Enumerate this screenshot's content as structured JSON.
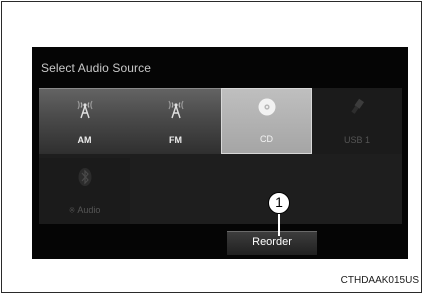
{
  "screen": {
    "title": "Select Audio Source"
  },
  "sources": [
    {
      "label": "AM",
      "icon": "antenna-icon",
      "state": "normal"
    },
    {
      "label": "FM",
      "icon": "antenna-icon",
      "state": "normal"
    },
    {
      "label": "CD",
      "icon": "disc-icon",
      "state": "selected"
    },
    {
      "label": "USB 1",
      "icon": "usb-icon",
      "state": "disabled"
    },
    {
      "label": "Audio",
      "icon": "bluetooth-icon",
      "state": "disabled"
    }
  ],
  "reorder": {
    "label": "Reorder"
  },
  "callout": {
    "number": "1"
  },
  "image_code": "CTHDAAK015US",
  "colors": {
    "screen_bg": "#050505",
    "tile_raised": "#4c4c4c",
    "tile_selected": "#a5a5a5",
    "text_light": "#ececec"
  }
}
